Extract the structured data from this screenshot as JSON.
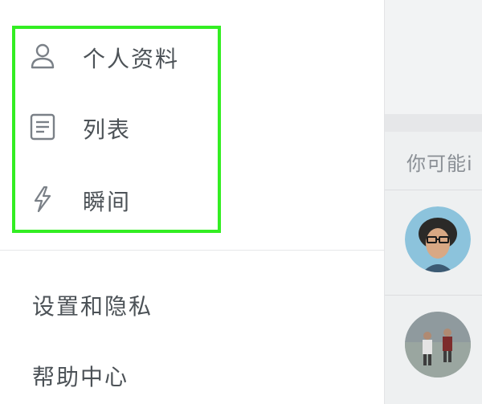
{
  "drawer": {
    "items": [
      {
        "label": "个人资料",
        "icon": "person-icon"
      },
      {
        "label": "列表",
        "icon": "list-icon"
      },
      {
        "label": "瞬间",
        "icon": "lightning-bolt-icon"
      }
    ],
    "secondary_items": [
      {
        "label": "设置和隐私"
      },
      {
        "label": "帮助中心"
      }
    ]
  },
  "background": {
    "suggestions_header": "你可能i"
  },
  "colors": {
    "highlight": "#33ee22",
    "text": "#4c5257",
    "muted": "#8a8f95"
  }
}
